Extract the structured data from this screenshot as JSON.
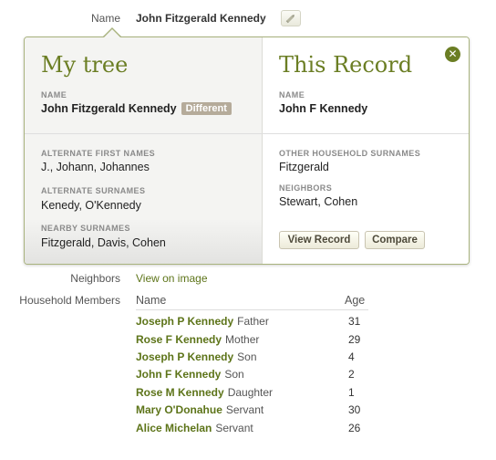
{
  "top": {
    "label": "Name",
    "value": "John Fitzgerald Kennedy",
    "edit_icon": "pencil-icon"
  },
  "popover": {
    "left": {
      "title": "My tree",
      "name_label": "NAME",
      "name_value": "John Fitzgerald Kennedy",
      "badge": "Different",
      "alt_first_label": "ALTERNATE FIRST NAMES",
      "alt_first_value": "J., Johann, Johannes",
      "alt_surnames_label": "ALTERNATE SURNAMES",
      "alt_surnames_value": "Kenedy, O'Kennedy",
      "nearby_label": "NEARBY SURNAMES",
      "nearby_value": "Fitzgerald, Davis, Cohen"
    },
    "right": {
      "title": "This Record",
      "name_label": "NAME",
      "name_value": "John F Kennedy",
      "other_household_label": "OTHER HOUSEHOLD SURNAMES",
      "other_household_value": "Fitzgerald",
      "neighbors_label": "NEIGHBORS",
      "neighbors_value": "Stewart, Cohen",
      "view_record": "View Record",
      "compare": "Compare"
    },
    "close_glyph": "✕",
    "close_icon": "close-icon"
  },
  "neighbors": {
    "label": "Neighbors",
    "link": "View on image"
  },
  "household": {
    "label": "Household Members",
    "col_name": "Name",
    "col_age": "Age",
    "members": [
      {
        "name": "Joseph P Kennedy",
        "relation": "Father",
        "age": "31"
      },
      {
        "name": "Rose F Kennedy",
        "relation": "Mother",
        "age": "29"
      },
      {
        "name": "Joseph P Kennedy",
        "relation": "Son",
        "age": "4"
      },
      {
        "name": "John F Kennedy",
        "relation": "Son",
        "age": "2"
      },
      {
        "name": "Rose M Kennedy",
        "relation": "Daughter",
        "age": "1"
      },
      {
        "name": "Mary O'Donahue",
        "relation": "Servant",
        "age": "30"
      },
      {
        "name": "Alice Michelan",
        "relation": "Servant",
        "age": "26"
      }
    ]
  },
  "colors": {
    "accent": "#6b7e24",
    "link": "#5d7419",
    "badge": "#b5ab9a",
    "border": "#a9b37e"
  }
}
